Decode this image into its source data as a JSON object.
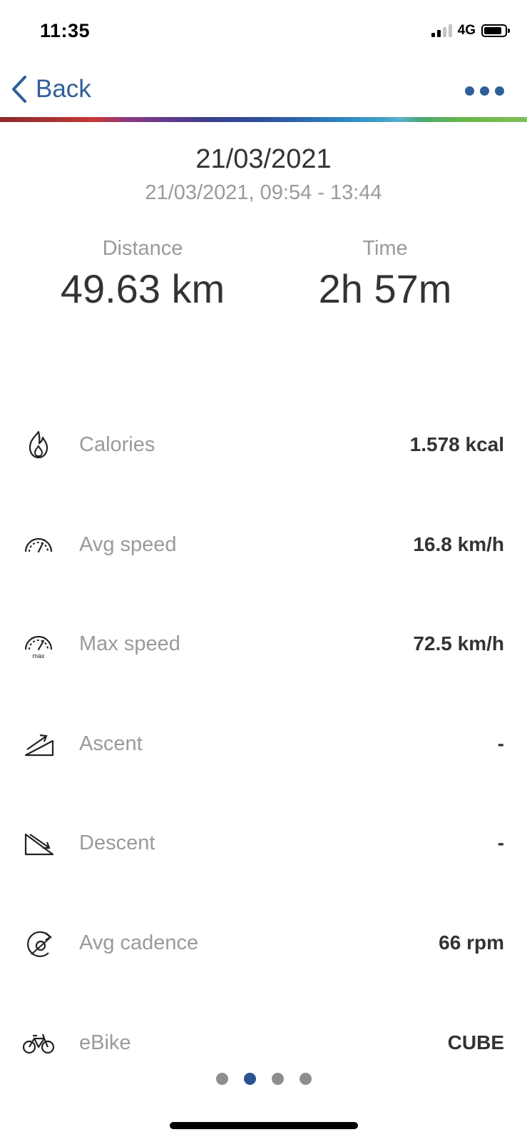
{
  "status_bar": {
    "time": "11:35",
    "network": "4G",
    "signal_bars_active": 2,
    "signal_bars_total": 4,
    "battery_level": 0.85
  },
  "nav": {
    "back_label": "Back",
    "back_icon": "chevron-left-icon",
    "more_icon": "more-horizontal-icon",
    "accent_color": "#2f5f9a"
  },
  "summary": {
    "date": "21/03/2021",
    "range": "21/03/2021, 09:54 - 13:44",
    "distance_label": "Distance",
    "distance_value": "49.63 km",
    "time_label": "Time",
    "time_value": "2h 57m"
  },
  "stats": [
    {
      "icon": "flame-icon",
      "label": "Calories",
      "value": "1.578 kcal"
    },
    {
      "icon": "speedometer-icon",
      "label": "Avg speed",
      "value": "16.8 km/h"
    },
    {
      "icon": "speedometer-max-icon",
      "label": "Max speed",
      "value": "72.5 km/h",
      "icon_text": "max"
    },
    {
      "icon": "ascent-icon",
      "label": "Ascent",
      "value": "-"
    },
    {
      "icon": "descent-icon",
      "label": "Descent",
      "value": "-"
    },
    {
      "icon": "cadence-icon",
      "label": "Avg cadence",
      "value": "66 rpm"
    },
    {
      "icon": "bicycle-icon",
      "label": "eBike",
      "value": "CUBE"
    }
  ],
  "pager": {
    "total": 4,
    "active_index": 1
  }
}
